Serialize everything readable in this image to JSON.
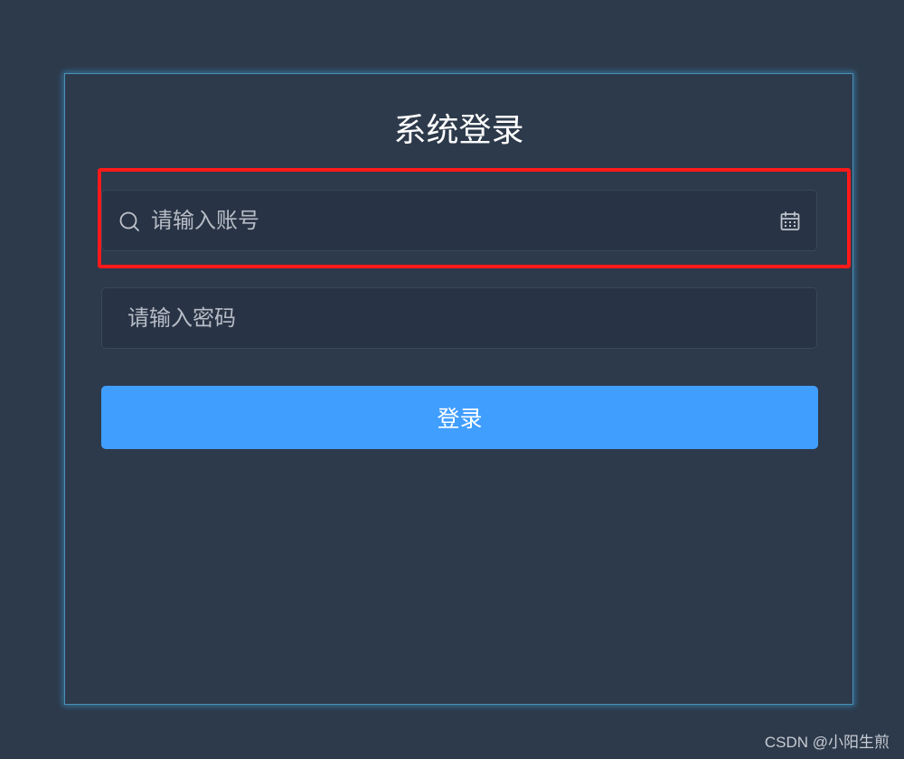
{
  "login": {
    "title": "系统登录",
    "account": {
      "value": "",
      "placeholder": "请输入账号",
      "prefix_icon": "search-icon",
      "suffix_icon": "calendar-icon"
    },
    "password": {
      "value": "",
      "placeholder": "请输入密码"
    },
    "submit_label": "登录"
  },
  "annotation": {
    "highlight_color": "#ff1a1a",
    "target": "account-input"
  },
  "watermark": "CSDN @小阳生煎",
  "colors": {
    "background": "#2d3a4b",
    "input_background": "#283445",
    "primary": "#409eff",
    "panel_glow": "#4a90b8"
  }
}
